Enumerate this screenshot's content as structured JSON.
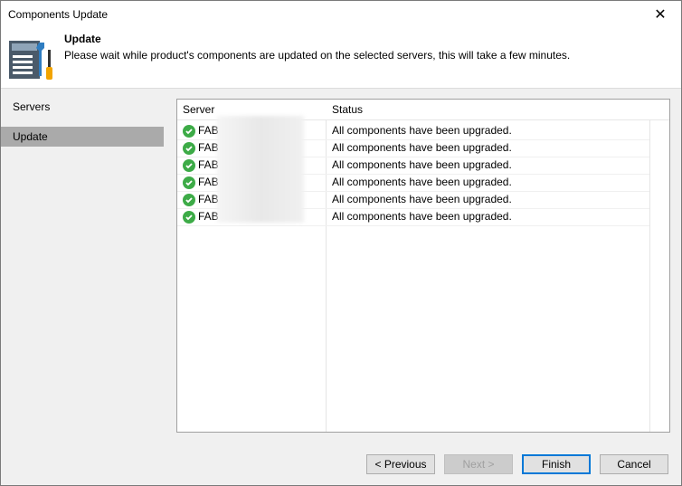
{
  "window": {
    "title": "Components Update"
  },
  "header": {
    "title": "Update",
    "description": "Please wait while product's components are updated on the selected servers, this will take a few minutes."
  },
  "sidebar": {
    "items": [
      {
        "label": "Servers",
        "active": false
      },
      {
        "label": "Update",
        "active": true
      }
    ]
  },
  "grid": {
    "columns": [
      "Server",
      "Status"
    ],
    "rows": [
      {
        "server": "FAB",
        "status": "All components have been upgraded."
      },
      {
        "server": "FAB",
        "status": "All components have been upgraded."
      },
      {
        "server": "FAB",
        "status": "All components have been upgraded."
      },
      {
        "server": "FAB",
        "status": "All components have been upgraded."
      },
      {
        "server": "FAB",
        "status": "All components have been upgraded."
      },
      {
        "server": "FAB",
        "status": "All components have been upgraded."
      }
    ]
  },
  "buttons": {
    "previous": "< Previous",
    "next": "Next >",
    "finish": "Finish",
    "cancel": "Cancel"
  },
  "colors": {
    "success": "#3dab47",
    "accent": "#0078d7"
  }
}
